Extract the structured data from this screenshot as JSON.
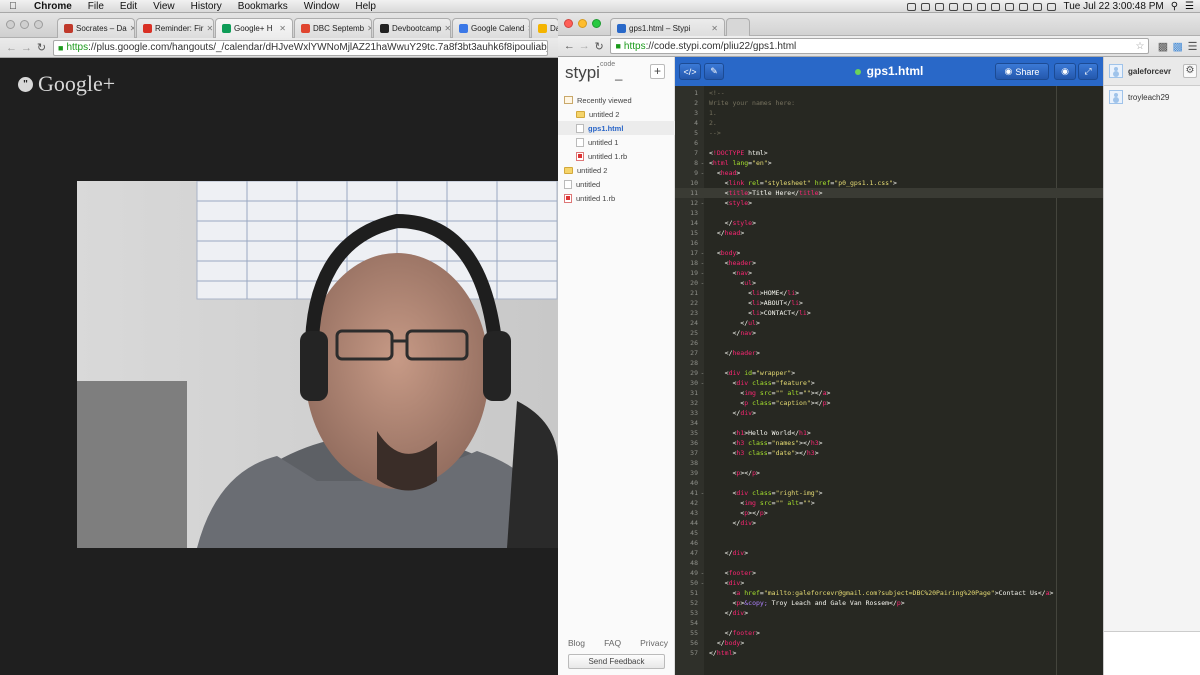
{
  "menubar": {
    "apple": "",
    "items": [
      "Chrome",
      "File",
      "Edit",
      "View",
      "History",
      "Bookmarks",
      "Window",
      "Help"
    ],
    "clock": "Tue Jul 22  3:00:48 PM"
  },
  "left_window": {
    "tabs": [
      {
        "label": "Socrates – Da",
        "color": "#c0392b"
      },
      {
        "label": "Reminder: Fir",
        "color": "#d93025"
      },
      {
        "label": "Google+ H",
        "color": "#0f9d58"
      },
      {
        "label": "DBC Septemb",
        "color": "#e0452f"
      },
      {
        "label": "Devbootcamp",
        "color": "#222222"
      },
      {
        "label": "Google Calend",
        "color": "#3b78e7"
      },
      {
        "label": "Das",
        "color": "#f4b400"
      }
    ],
    "url_https": "https",
    "url_rest": "://plus.google.com/hangouts/_/calendar/dHJveWxlYWNoMjlAZ21haWwuY29tc.7a8f3bt3auhk6f8ipouliabjn8",
    "logo_text": "Google+",
    "logo_badge": "\""
  },
  "right_window": {
    "tab_label": "gps1.html – Stypi",
    "url_https": "https",
    "url_rest": "://code.stypi.com/pliu22/gps1.html",
    "stypi": {
      "logo": "stypi",
      "logo_sup": "code",
      "logo_cursor": "_",
      "plus": "+",
      "tree": [
        {
          "label": "Recently viewed",
          "icon": "clock",
          "indent": 6
        },
        {
          "label": "untitled 2",
          "icon": "folder",
          "indent": 18
        },
        {
          "label": "gps1.html",
          "icon": "file",
          "indent": 18,
          "active": true
        },
        {
          "label": "untitled 1",
          "icon": "file",
          "indent": 18
        },
        {
          "label": "untitled 1.rb",
          "icon": "ruby",
          "indent": 18
        },
        {
          "label": "untitled 2",
          "icon": "folder",
          "indent": 6
        },
        {
          "label": "untitled",
          "icon": "file",
          "indent": 6
        },
        {
          "label": "untitled 1.rb",
          "icon": "ruby",
          "indent": 6
        }
      ],
      "footer_links": [
        "Blog",
        "FAQ",
        "Privacy"
      ],
      "feedback": "Send Feedback"
    },
    "editor": {
      "title": "gps1.html",
      "code_btn": "</>",
      "pen_btn": "✎",
      "share": "Share",
      "eye": "◉",
      "expand": "⤢"
    },
    "users": {
      "me": "galeforcevr",
      "other": "troyleach29",
      "gear": "⚙"
    }
  },
  "colors": {
    "editor_bg": "#272822",
    "header_blue": "#2968c8",
    "tag": "#f92672",
    "attr": "#a6e22e",
    "string": "#e6db74",
    "comment": "#75715e"
  },
  "code": [
    {
      "n": 1,
      "fold": "",
      "t": [
        [
          "c-com",
          "<!--"
        ]
      ]
    },
    {
      "n": 2,
      "fold": "",
      "t": [
        [
          "c-com",
          "Write your names here:"
        ]
      ]
    },
    {
      "n": 3,
      "fold": "",
      "t": [
        [
          "c-com",
          "1."
        ]
      ]
    },
    {
      "n": 4,
      "fold": "",
      "t": [
        [
          "c-com",
          "2."
        ]
      ]
    },
    {
      "n": 5,
      "fold": "",
      "t": [
        [
          "c-com",
          "-->"
        ]
      ]
    },
    {
      "n": 6,
      "fold": "",
      "t": []
    },
    {
      "n": 7,
      "fold": "",
      "t": [
        [
          "c-pl",
          "<"
        ],
        [
          "c-tag",
          "!DOCTYPE"
        ],
        [
          "c-pl",
          " html>"
        ]
      ]
    },
    {
      "n": 8,
      "fold": "-",
      "t": [
        [
          "c-pl",
          "<"
        ],
        [
          "c-tag",
          "html"
        ],
        [
          "c-pl",
          " "
        ],
        [
          "c-attr",
          "lang"
        ],
        [
          "c-pl",
          "="
        ],
        [
          "c-str",
          "\"en\""
        ],
        [
          "c-pl",
          ">"
        ]
      ]
    },
    {
      "n": 9,
      "fold": "-",
      "t": [
        [
          "c-pl",
          "  <"
        ],
        [
          "c-tag",
          "head"
        ],
        [
          "c-pl",
          ">"
        ]
      ]
    },
    {
      "n": 10,
      "fold": "",
      "t": [
        [
          "c-pl",
          "    <"
        ],
        [
          "c-tag",
          "link"
        ],
        [
          "c-pl",
          " "
        ],
        [
          "c-attr",
          "rel"
        ],
        [
          "c-pl",
          "="
        ],
        [
          "c-str",
          "\"stylesheet\""
        ],
        [
          "c-pl",
          " "
        ],
        [
          "c-attr",
          "href"
        ],
        [
          "c-pl",
          "="
        ],
        [
          "c-str",
          "\"p0_gps1.1.css\""
        ],
        [
          "c-pl",
          ">"
        ]
      ]
    },
    {
      "n": 11,
      "fold": "",
      "hl": true,
      "t": [
        [
          "c-pl",
          "    <"
        ],
        [
          "c-tag",
          "title"
        ],
        [
          "c-pl",
          ">Title Here</"
        ],
        [
          "c-tag",
          "title"
        ],
        [
          "c-pl",
          ">"
        ]
      ]
    },
    {
      "n": 12,
      "fold": "-",
      "t": [
        [
          "c-pl",
          "    <"
        ],
        [
          "c-tag",
          "style"
        ],
        [
          "c-pl",
          ">"
        ]
      ]
    },
    {
      "n": 13,
      "fold": "",
      "t": []
    },
    {
      "n": 14,
      "fold": "",
      "t": [
        [
          "c-pl",
          "    </"
        ],
        [
          "c-tag",
          "style"
        ],
        [
          "c-pl",
          ">"
        ]
      ]
    },
    {
      "n": 15,
      "fold": "",
      "t": [
        [
          "c-pl",
          "  </"
        ],
        [
          "c-tag",
          "head"
        ],
        [
          "c-pl",
          ">"
        ]
      ]
    },
    {
      "n": 16,
      "fold": "",
      "t": []
    },
    {
      "n": 17,
      "fold": "-",
      "t": [
        [
          "c-pl",
          "  <"
        ],
        [
          "c-tag",
          "body"
        ],
        [
          "c-pl",
          ">"
        ]
      ]
    },
    {
      "n": 18,
      "fold": "-",
      "t": [
        [
          "c-pl",
          "    <"
        ],
        [
          "c-tag",
          "header"
        ],
        [
          "c-pl",
          ">"
        ]
      ]
    },
    {
      "n": 19,
      "fold": "-",
      "t": [
        [
          "c-pl",
          "      <"
        ],
        [
          "c-tag",
          "nav"
        ],
        [
          "c-pl",
          ">"
        ]
      ]
    },
    {
      "n": 20,
      "fold": "-",
      "t": [
        [
          "c-pl",
          "        <"
        ],
        [
          "c-tag",
          "ul"
        ],
        [
          "c-pl",
          ">"
        ]
      ]
    },
    {
      "n": 21,
      "fold": "",
      "t": [
        [
          "c-pl",
          "          <"
        ],
        [
          "c-tag",
          "li"
        ],
        [
          "c-pl",
          ">HOME</"
        ],
        [
          "c-tag",
          "li"
        ],
        [
          "c-pl",
          ">"
        ]
      ]
    },
    {
      "n": 22,
      "fold": "",
      "t": [
        [
          "c-pl",
          "          <"
        ],
        [
          "c-tag",
          "li"
        ],
        [
          "c-pl",
          ">ABOUT</"
        ],
        [
          "c-tag",
          "li"
        ],
        [
          "c-pl",
          ">"
        ]
      ]
    },
    {
      "n": 23,
      "fold": "",
      "t": [
        [
          "c-pl",
          "          <"
        ],
        [
          "c-tag",
          "li"
        ],
        [
          "c-pl",
          ">CONTACT</"
        ],
        [
          "c-tag",
          "li"
        ],
        [
          "c-pl",
          ">"
        ]
      ]
    },
    {
      "n": 24,
      "fold": "",
      "t": [
        [
          "c-pl",
          "        </"
        ],
        [
          "c-tag",
          "ul"
        ],
        [
          "c-pl",
          ">"
        ]
      ]
    },
    {
      "n": 25,
      "fold": "",
      "t": [
        [
          "c-pl",
          "      </"
        ],
        [
          "c-tag",
          "nav"
        ],
        [
          "c-pl",
          ">"
        ]
      ]
    },
    {
      "n": 26,
      "fold": "",
      "t": []
    },
    {
      "n": 27,
      "fold": "",
      "t": [
        [
          "c-pl",
          "    </"
        ],
        [
          "c-tag",
          "header"
        ],
        [
          "c-pl",
          ">"
        ]
      ]
    },
    {
      "n": 28,
      "fold": "",
      "t": []
    },
    {
      "n": 29,
      "fold": "-",
      "t": [
        [
          "c-pl",
          "    <"
        ],
        [
          "c-tag",
          "div"
        ],
        [
          "c-pl",
          " "
        ],
        [
          "c-attr",
          "id"
        ],
        [
          "c-pl",
          "="
        ],
        [
          "c-str",
          "\"wrapper\""
        ],
        [
          "c-pl",
          ">"
        ]
      ]
    },
    {
      "n": 30,
      "fold": "-",
      "t": [
        [
          "c-pl",
          "      <"
        ],
        [
          "c-tag",
          "div"
        ],
        [
          "c-pl",
          " "
        ],
        [
          "c-attr",
          "class"
        ],
        [
          "c-pl",
          "="
        ],
        [
          "c-str",
          "\"feature\""
        ],
        [
          "c-pl",
          ">"
        ]
      ]
    },
    {
      "n": 31,
      "fold": "",
      "t": [
        [
          "c-pl",
          "        <"
        ],
        [
          "c-tag",
          "img"
        ],
        [
          "c-pl",
          " "
        ],
        [
          "c-attr",
          "src"
        ],
        [
          "c-pl",
          "="
        ],
        [
          "c-str",
          "\"\""
        ],
        [
          "c-pl",
          " "
        ],
        [
          "c-attr",
          "alt"
        ],
        [
          "c-pl",
          "="
        ],
        [
          "c-str",
          "\"\""
        ],
        [
          "c-pl",
          "></"
        ],
        [
          "c-tag",
          "a"
        ],
        [
          "c-pl",
          ">"
        ]
      ]
    },
    {
      "n": 32,
      "fold": "",
      "t": [
        [
          "c-pl",
          "        <"
        ],
        [
          "c-tag",
          "p"
        ],
        [
          "c-pl",
          " "
        ],
        [
          "c-attr",
          "class"
        ],
        [
          "c-pl",
          "="
        ],
        [
          "c-str",
          "\"caption\""
        ],
        [
          "c-pl",
          "></"
        ],
        [
          "c-tag",
          "p"
        ],
        [
          "c-pl",
          ">"
        ]
      ]
    },
    {
      "n": 33,
      "fold": "",
      "t": [
        [
          "c-pl",
          "      </"
        ],
        [
          "c-tag",
          "div"
        ],
        [
          "c-pl",
          ">"
        ]
      ]
    },
    {
      "n": 34,
      "fold": "",
      "t": []
    },
    {
      "n": 35,
      "fold": "",
      "t": [
        [
          "c-pl",
          "      <"
        ],
        [
          "c-tag",
          "h1"
        ],
        [
          "c-pl",
          ">Hello World</"
        ],
        [
          "c-tag",
          "h1"
        ],
        [
          "c-pl",
          ">"
        ]
      ]
    },
    {
      "n": 36,
      "fold": "",
      "t": [
        [
          "c-pl",
          "      <"
        ],
        [
          "c-tag",
          "h3"
        ],
        [
          "c-pl",
          " "
        ],
        [
          "c-attr",
          "class"
        ],
        [
          "c-pl",
          "="
        ],
        [
          "c-str",
          "\"names\""
        ],
        [
          "c-pl",
          "></"
        ],
        [
          "c-tag",
          "h3"
        ],
        [
          "c-pl",
          ">"
        ]
      ]
    },
    {
      "n": 37,
      "fold": "",
      "t": [
        [
          "c-pl",
          "      <"
        ],
        [
          "c-tag",
          "h3"
        ],
        [
          "c-pl",
          " "
        ],
        [
          "c-attr",
          "class"
        ],
        [
          "c-pl",
          "="
        ],
        [
          "c-str",
          "\"date\""
        ],
        [
          "c-pl",
          "></"
        ],
        [
          "c-tag",
          "h3"
        ],
        [
          "c-pl",
          ">"
        ]
      ]
    },
    {
      "n": 38,
      "fold": "",
      "t": []
    },
    {
      "n": 39,
      "fold": "",
      "t": [
        [
          "c-pl",
          "      <"
        ],
        [
          "c-tag",
          "p"
        ],
        [
          "c-pl",
          "></"
        ],
        [
          "c-tag",
          "p"
        ],
        [
          "c-pl",
          ">"
        ]
      ]
    },
    {
      "n": 40,
      "fold": "",
      "t": []
    },
    {
      "n": 41,
      "fold": "-",
      "t": [
        [
          "c-pl",
          "      <"
        ],
        [
          "c-tag",
          "div"
        ],
        [
          "c-pl",
          " "
        ],
        [
          "c-attr",
          "class"
        ],
        [
          "c-pl",
          "="
        ],
        [
          "c-str",
          "\"right-img\""
        ],
        [
          "c-pl",
          ">"
        ]
      ]
    },
    {
      "n": 42,
      "fold": "",
      "t": [
        [
          "c-pl",
          "        <"
        ],
        [
          "c-tag",
          "img"
        ],
        [
          "c-pl",
          " "
        ],
        [
          "c-attr",
          "src"
        ],
        [
          "c-pl",
          "="
        ],
        [
          "c-str",
          "\"\""
        ],
        [
          "c-pl",
          " "
        ],
        [
          "c-attr",
          "alt"
        ],
        [
          "c-pl",
          "="
        ],
        [
          "c-str",
          "\"\""
        ],
        [
          "c-pl",
          ">"
        ]
      ]
    },
    {
      "n": 43,
      "fold": "",
      "t": [
        [
          "c-pl",
          "        <"
        ],
        [
          "c-tag",
          "p"
        ],
        [
          "c-pl",
          "></"
        ],
        [
          "c-tag",
          "p"
        ],
        [
          "c-pl",
          ">"
        ]
      ]
    },
    {
      "n": 44,
      "fold": "",
      "t": [
        [
          "c-pl",
          "      </"
        ],
        [
          "c-tag",
          "div"
        ],
        [
          "c-pl",
          ">"
        ]
      ]
    },
    {
      "n": 45,
      "fold": "",
      "t": []
    },
    {
      "n": 46,
      "fold": "",
      "t": []
    },
    {
      "n": 47,
      "fold": "",
      "t": [
        [
          "c-pl",
          "    </"
        ],
        [
          "c-tag",
          "div"
        ],
        [
          "c-pl",
          ">"
        ]
      ]
    },
    {
      "n": 48,
      "fold": "",
      "t": []
    },
    {
      "n": 49,
      "fold": "-",
      "t": [
        [
          "c-pl",
          "    <"
        ],
        [
          "c-tag",
          "footer"
        ],
        [
          "c-pl",
          ">"
        ]
      ]
    },
    {
      "n": 50,
      "fold": "-",
      "t": [
        [
          "c-pl",
          "    <"
        ],
        [
          "c-tag",
          "div"
        ],
        [
          "c-pl",
          ">"
        ]
      ]
    },
    {
      "n": 51,
      "fold": "",
      "t": [
        [
          "c-pl",
          "      <"
        ],
        [
          "c-tag",
          "a"
        ],
        [
          "c-pl",
          " "
        ],
        [
          "c-attr",
          "href"
        ],
        [
          "c-pl",
          "="
        ],
        [
          "c-str",
          "\"mailto:galeforcevr@gmail.com?subject=DBC%20Pairing%20Page\""
        ],
        [
          "c-pl",
          ">Contact Us</"
        ],
        [
          "c-tag",
          "a"
        ],
        [
          "c-pl",
          ">"
        ]
      ]
    },
    {
      "n": 52,
      "fold": "",
      "t": [
        [
          "c-pl",
          "      <"
        ],
        [
          "c-tag",
          "p"
        ],
        [
          "c-pl",
          ">"
        ],
        [
          "c-ent",
          "&copy;"
        ],
        [
          "c-pl",
          " Troy Leach and Gale Van Rossem</"
        ],
        [
          "c-tag",
          "p"
        ],
        [
          "c-pl",
          ">"
        ]
      ]
    },
    {
      "n": 53,
      "fold": "",
      "t": [
        [
          "c-pl",
          "    </"
        ],
        [
          "c-tag",
          "div"
        ],
        [
          "c-pl",
          ">"
        ]
      ]
    },
    {
      "n": 54,
      "fold": "",
      "t": []
    },
    {
      "n": 55,
      "fold": "",
      "t": [
        [
          "c-pl",
          "    </"
        ],
        [
          "c-tag",
          "footer"
        ],
        [
          "c-pl",
          ">"
        ]
      ]
    },
    {
      "n": 56,
      "fold": "",
      "t": [
        [
          "c-pl",
          "  </"
        ],
        [
          "c-tag",
          "body"
        ],
        [
          "c-pl",
          ">"
        ]
      ]
    },
    {
      "n": 57,
      "fold": "",
      "t": [
        [
          "c-pl",
          "</"
        ],
        [
          "c-tag",
          "html"
        ],
        [
          "c-pl",
          ">"
        ]
      ]
    }
  ]
}
